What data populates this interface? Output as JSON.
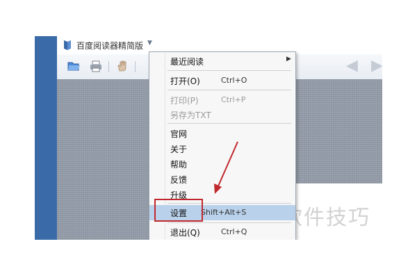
{
  "app": {
    "title": "百度阅读器精简版",
    "title_dropdown": "▼"
  },
  "toolbar": {
    "back_icon": "◀",
    "forward_icon": "▶"
  },
  "menu": {
    "items": [
      {
        "label": "最近阅读",
        "shortcut": "",
        "submenu": "▶"
      },
      {
        "label": "打开(O)",
        "shortcut": "Ctrl+O"
      },
      {
        "label": "打印(P)",
        "shortcut": "Ctrl+P"
      },
      {
        "label": "另存为TXT",
        "shortcut": ""
      },
      {
        "label": "官网",
        "shortcut": ""
      },
      {
        "label": "关于",
        "shortcut": ""
      },
      {
        "label": "帮助",
        "shortcut": ""
      },
      {
        "label": "反馈",
        "shortcut": ""
      },
      {
        "label": "升级",
        "shortcut": ""
      },
      {
        "label": "设置",
        "shortcut": "Shift+Alt+S"
      },
      {
        "label": "退出(Q)",
        "shortcut": "Ctrl+Q"
      }
    ]
  },
  "watermark": "软件技巧",
  "colors": {
    "annotation_red": "#c0282d",
    "highlight": "#b9d1ea",
    "sidebar_blue": "#3b6aa8"
  }
}
